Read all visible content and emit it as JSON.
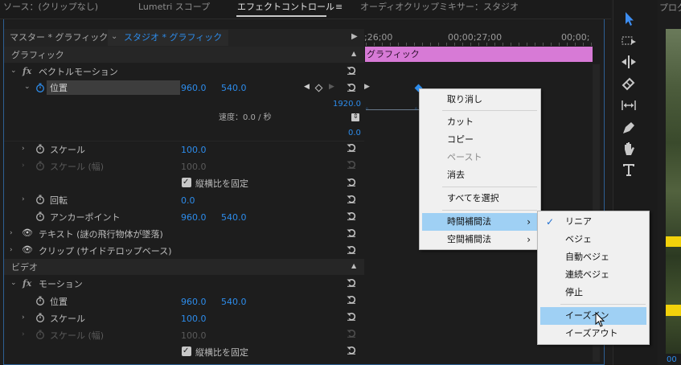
{
  "tabs": {
    "source": "ソース：(クリップなし)",
    "lumetri": "Lumetri スコープ",
    "effect_controls": "エフェクトコントロール",
    "effect_menu_glyph": "≡",
    "audio_mixer": "オーディオクリップミキサー：スタジオ",
    "program": "プログ"
  },
  "clip_header": {
    "master": "マスター * グラフィック",
    "studio": "スタジオ * グラフィック"
  },
  "timeline": {
    "tc1": ";26;00",
    "tc2": "00;00;27;00",
    "tc3": "00;00;",
    "clip_label": "グラフィック"
  },
  "sections": {
    "graphics": "グラフィック",
    "video": "ビデオ"
  },
  "properties": {
    "vector_motion": "ベクトルモーション",
    "position": "位置",
    "position_x": "960.0",
    "position_y": "540.0",
    "graph_max": "1920.0",
    "graph_min": "0.0",
    "velocity": "速度：0.0 / 秒",
    "scale": "スケール",
    "scale_value": "100.0",
    "scale_width": "スケール (幅)",
    "scale_width_value": "100.0",
    "uniform_scale": "縦横比を固定",
    "rotation": "回転",
    "rotation_value": "0.0",
    "anchor": "アンカーポイント",
    "anchor_x": "960.0",
    "anchor_y": "540.0",
    "text_layer": "テキスト (謎の飛行物体が墜落)",
    "clip_layer": "クリップ (サイドテロップベース)",
    "motion": "モーション",
    "m_position": "位置",
    "m_position_x": "960.0",
    "m_position_y": "540.0",
    "m_scale": "スケール",
    "m_scale_value": "100.0",
    "m_scale_width": "スケール (幅)",
    "m_scale_width_value": "100.0",
    "m_uniform_scale": "縦横比を固定"
  },
  "context_menu": {
    "undo": "取り消し",
    "cut": "カット",
    "copy": "コピー",
    "paste": "ペースト",
    "clear": "消去",
    "select_all": "すべてを選択",
    "temporal": "時間補間法",
    "spatial": "空間補間法"
  },
  "submenu": {
    "linear": "リニア",
    "bezier": "ベジェ",
    "auto_bezier": "自動ベジェ",
    "continuous_bezier": "連続ベジェ",
    "hold": "停止",
    "ease_in": "イーズイン",
    "ease_out": "イーズアウト"
  },
  "preview": {
    "timecode": "00"
  },
  "colors": {
    "accent_blue": "#2d8ceb",
    "clip_pink": "#d77ad6",
    "panel_bg": "#1d1d1d",
    "menu_highlight": "#9fd0f4"
  }
}
